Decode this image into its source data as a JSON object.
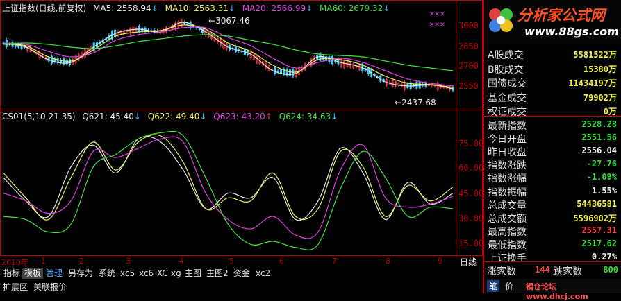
{
  "chart_header": {
    "title": "上证指数(日线,前复权)",
    "ma5": "MA5: 2558.94",
    "ma10": "MA10: 2563.31",
    "ma20": "MA20: 2566.99",
    "ma60": "MA60: 2679.32"
  },
  "indicator_header": {
    "name": "CS01(5,10,21,35)",
    "q621": "Q621: 45.40",
    "q622": "Q622: 49.40",
    "q623": "Q623: 43.20",
    "q624": "Q624: 34.63"
  },
  "annotations": {
    "high": "3067.46",
    "low": "2437.68"
  },
  "price_axis": [
    "3000",
    "2850",
    "2700",
    "2550"
  ],
  "ind_axis": [
    "75.00",
    "60.00",
    "45.00",
    "30.00",
    "15.00"
  ],
  "x_axis": [
    "2010年",
    "1",
    "2",
    "3",
    "4",
    "5",
    "6",
    "7",
    "8",
    "9"
  ],
  "period_label": "日线",
  "logo": {
    "title": "分析家公式网",
    "url": "www.88gs.com"
  },
  "panel": {
    "rows": [
      {
        "k": "A股成交",
        "v": "5581522万",
        "color": "#f0f040"
      },
      {
        "k": "B股成交",
        "v": "15380万",
        "color": "#f0f040"
      },
      {
        "k": "国债成交",
        "v": "11434197万",
        "color": "#f0f040"
      },
      {
        "k": "基金成交",
        "v": "79902万",
        "color": "#f0f040"
      },
      {
        "k": "权证成交",
        "v": "0万",
        "color": "#f0f040"
      },
      {
        "k": "最新指数",
        "v": "2528.28",
        "color": "#30e030"
      },
      {
        "k": "今日开盘",
        "v": "2551.56",
        "color": "#30e030"
      },
      {
        "k": "昨日收盘",
        "v": "2556.04",
        "color": "#f0f0f0"
      },
      {
        "k": "指数涨跌",
        "v": "-27.76",
        "color": "#30e030"
      },
      {
        "k": "指数涨幅",
        "v": "-1.09%",
        "color": "#30e030"
      },
      {
        "k": "指数振幅",
        "v": "1.55%",
        "color": "#f0f0f0"
      },
      {
        "k": "总成交量",
        "v": "54436581",
        "color": "#f0f040"
      },
      {
        "k": "总成交额",
        "v": "5596902万",
        "color": "#f0f040"
      },
      {
        "k": "最高指数",
        "v": "2557.31",
        "color": "#ff4040"
      },
      {
        "k": "最低指数",
        "v": "2517.62",
        "color": "#30e030"
      },
      {
        "k": "上证换手",
        "v": "0.27%",
        "color": "#f0f0f0"
      }
    ],
    "up_label": "涨家数",
    "up_value": "144",
    "down_label": "跌家数",
    "down_value": "800",
    "bottom_left": "笔",
    "bottom_mid": "价",
    "watermark": "钢仓论坛 www.dhcj.com"
  },
  "tabs": [
    "指标",
    "模板",
    "管理",
    "另存为",
    "系统",
    "xc5",
    "xc6",
    "XC",
    "xg",
    "主图",
    "主图2",
    "资金",
    "xc2"
  ],
  "bottom_links": [
    "扩展区",
    "关联报价"
  ],
  "chart_data": [
    {
      "type": "line",
      "title": "上证指数(日线,前复权)",
      "ylim": [
        2400,
        3100
      ],
      "x": [
        0,
        5,
        10,
        15,
        20,
        25,
        30,
        35,
        40,
        45,
        50,
        55,
        60,
        65,
        70,
        75,
        80,
        85,
        90,
        95,
        100
      ],
      "series": [
        {
          "name": "MA5",
          "values": [
            2880,
            2850,
            2760,
            2740,
            2850,
            2950,
            2980,
            2960,
            3030,
            2960,
            2850,
            2800,
            2680,
            2660,
            2780,
            2740,
            2700,
            2600,
            2570,
            2580,
            2550
          ]
        },
        {
          "name": "MA10",
          "values": [
            2870,
            2860,
            2780,
            2750,
            2830,
            2930,
            2960,
            2970,
            3010,
            2980,
            2880,
            2820,
            2720,
            2670,
            2760,
            2760,
            2720,
            2640,
            2590,
            2580,
            2560
          ]
        },
        {
          "name": "MA20",
          "values": [
            2880,
            2870,
            2820,
            2780,
            2810,
            2900,
            2940,
            2960,
            2990,
            2990,
            2920,
            2860,
            2770,
            2700,
            2740,
            2770,
            2740,
            2680,
            2620,
            2590,
            2570
          ]
        },
        {
          "name": "MA60",
          "values": [
            2870,
            2880,
            2870,
            2850,
            2840,
            2860,
            2890,
            2910,
            2930,
            2940,
            2930,
            2900,
            2870,
            2830,
            2800,
            2790,
            2780,
            2750,
            2720,
            2700,
            2680
          ]
        }
      ]
    },
    {
      "type": "line",
      "title": "CS01(5,10,21,35)",
      "ylim": [
        5,
        90
      ],
      "x": [
        0,
        5,
        10,
        15,
        20,
        25,
        30,
        35,
        40,
        45,
        50,
        55,
        60,
        65,
        70,
        75,
        80,
        85,
        90,
        95,
        100
      ],
      "series": [
        {
          "name": "Q621",
          "values": [
            55,
            40,
            30,
            62,
            76,
            58,
            80,
            78,
            60,
            35,
            45,
            42,
            55,
            28,
            40,
            74,
            58,
            28,
            52,
            38,
            45
          ]
        },
        {
          "name": "Q622",
          "values": [
            58,
            42,
            28,
            55,
            78,
            60,
            78,
            82,
            65,
            35,
            42,
            40,
            58,
            30,
            35,
            72,
            62,
            30,
            50,
            40,
            49
          ]
        },
        {
          "name": "Q623",
          "values": [
            45,
            40,
            32,
            40,
            72,
            68,
            74,
            80,
            78,
            45,
            28,
            22,
            30,
            18,
            20,
            60,
            76,
            42,
            36,
            38,
            43
          ]
        },
        {
          "name": "Q624",
          "values": [
            30,
            28,
            20,
            25,
            62,
            70,
            80,
            84,
            82,
            55,
            25,
            12,
            14,
            10,
            12,
            48,
            72,
            55,
            30,
            36,
            35
          ]
        }
      ]
    }
  ]
}
